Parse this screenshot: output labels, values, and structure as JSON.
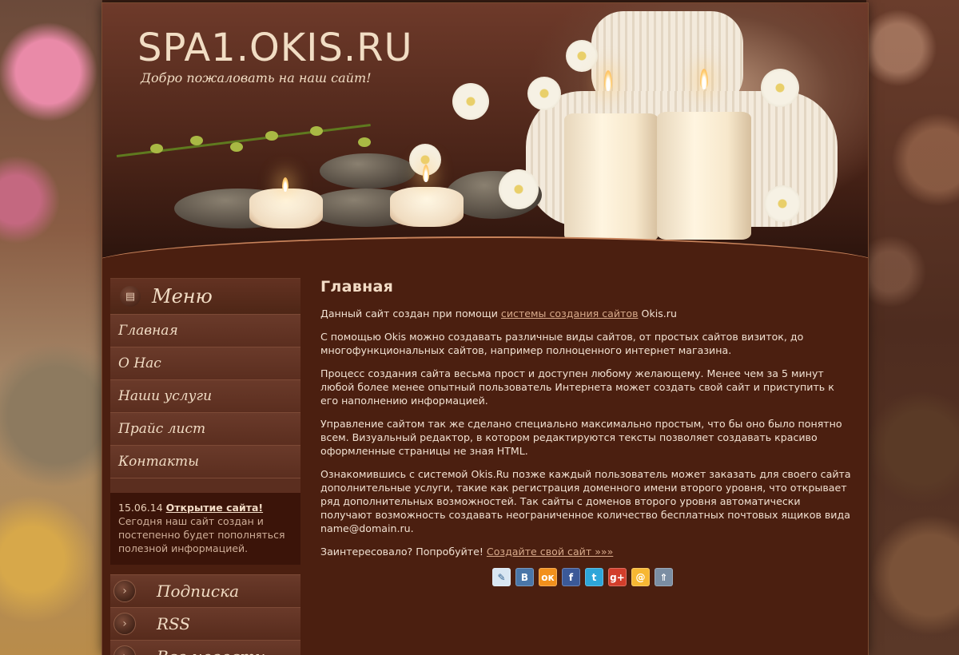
{
  "header": {
    "site_title": "SPA1.OKIS.RU",
    "tagline": "Добро пожаловать на наш сайт!"
  },
  "sidebar": {
    "menu_title": "Меню",
    "menu_items": [
      {
        "label": "Главная"
      },
      {
        "label": "О Нас"
      },
      {
        "label": "Наши услуги"
      },
      {
        "label": "Прайс лист"
      },
      {
        "label": "Контакты"
      }
    ],
    "news": {
      "date": "15.06.14",
      "title": "Открытие сайта!",
      "text": "Сегодня наш сайт создан и постепенно будет пополняться полезной информацией."
    },
    "promo_items": [
      {
        "label": "Подписка"
      },
      {
        "label": "RSS"
      },
      {
        "label": "Все новости"
      }
    ]
  },
  "main": {
    "page_title": "Главная",
    "p1_before": "Данный сайт создан при помощи ",
    "p1_link": "системы создания сайтов",
    "p1_after": " Okis.ru",
    "p2": "С помощью Okis можно создавать различные виды сайтов, от простых сайтов визиток, до многофункциональных сайтов, например полноценного интернет магазина.",
    "p3": "Процесс создания сайта весьма прост и доступен любому желающему. Менее чем за 5 минут любой более менее опытный пользователь Интернета может создать свой сайт и приступить к его наполнению информацией.",
    "p4": "Управление сайтом так же сделано специально максимально простым, что бы оно было понятно всем. Визуальный редактор, в котором редактируются тексты позволяет создавать красиво оформленные страницы не зная HTML.",
    "p5": "Ознакомившись с системой Okis.Ru позже каждый пользователь может заказать для своего сайта дополнительные услуги, такие как регистрация доменного имени второго уровня, что открывает ряд дополнительных возможностей. Так сайты с доменов второго уровня автоматически получают возможность создавать неограниченное количество бесплатных почтовых ящиков вида name@domain.ru.",
    "p6_text": "Заинтересовало? Попробуйте! ",
    "p6_link": "Создайте свой сайт »»»"
  },
  "share_buttons": [
    {
      "icon": "livejournal-icon",
      "glyph": "✎",
      "color": "#d9e6f2"
    },
    {
      "icon": "vkontakte-icon",
      "glyph": "B",
      "color": "#4a76a8"
    },
    {
      "icon": "odnoklassniki-icon",
      "glyph": "ок",
      "color": "#f2901c"
    },
    {
      "icon": "facebook-icon",
      "glyph": "f",
      "color": "#3b5998"
    },
    {
      "icon": "twitter-icon",
      "glyph": "t",
      "color": "#2ea6d9"
    },
    {
      "icon": "google-plus-icon",
      "glyph": "g+",
      "color": "#d23e2b"
    },
    {
      "icon": "mail-ru-icon",
      "glyph": "@",
      "color": "#f7b733"
    },
    {
      "icon": "more-share-icon",
      "glyph": "⇑",
      "color": "#7b8ea3"
    }
  ]
}
